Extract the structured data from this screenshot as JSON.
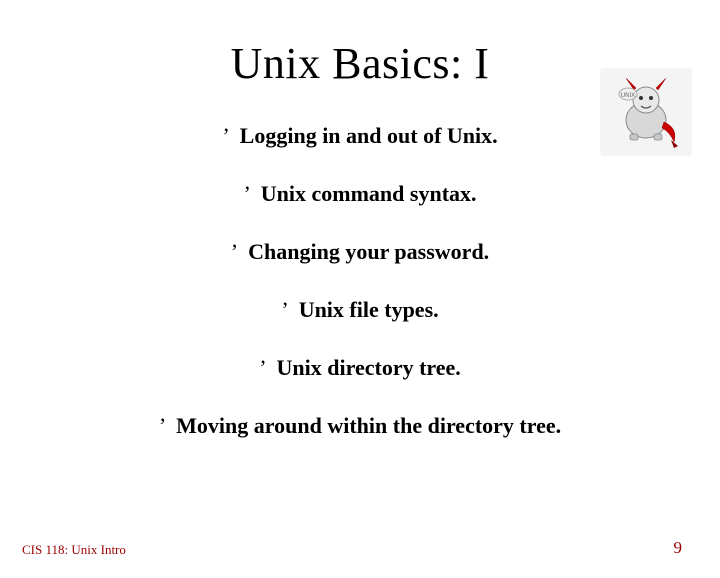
{
  "slide": {
    "title": "Unix Basics: I",
    "bullets": [
      {
        "mark": "’",
        "text": "Logging in and out of Unix."
      },
      {
        "mark": "’",
        "text": "Unix command syntax."
      },
      {
        "mark": "’",
        "text": "Changing your password."
      },
      {
        "mark": "’",
        "text": "Unix file types."
      },
      {
        "mark": "’",
        "text": "Unix directory tree."
      },
      {
        "mark": "’",
        "text": "Moving around within the directory tree."
      }
    ]
  },
  "footer": {
    "left": "CIS 118: Unix Intro",
    "right": "9"
  },
  "logo": {
    "name": "bsd-daemon-icon"
  }
}
